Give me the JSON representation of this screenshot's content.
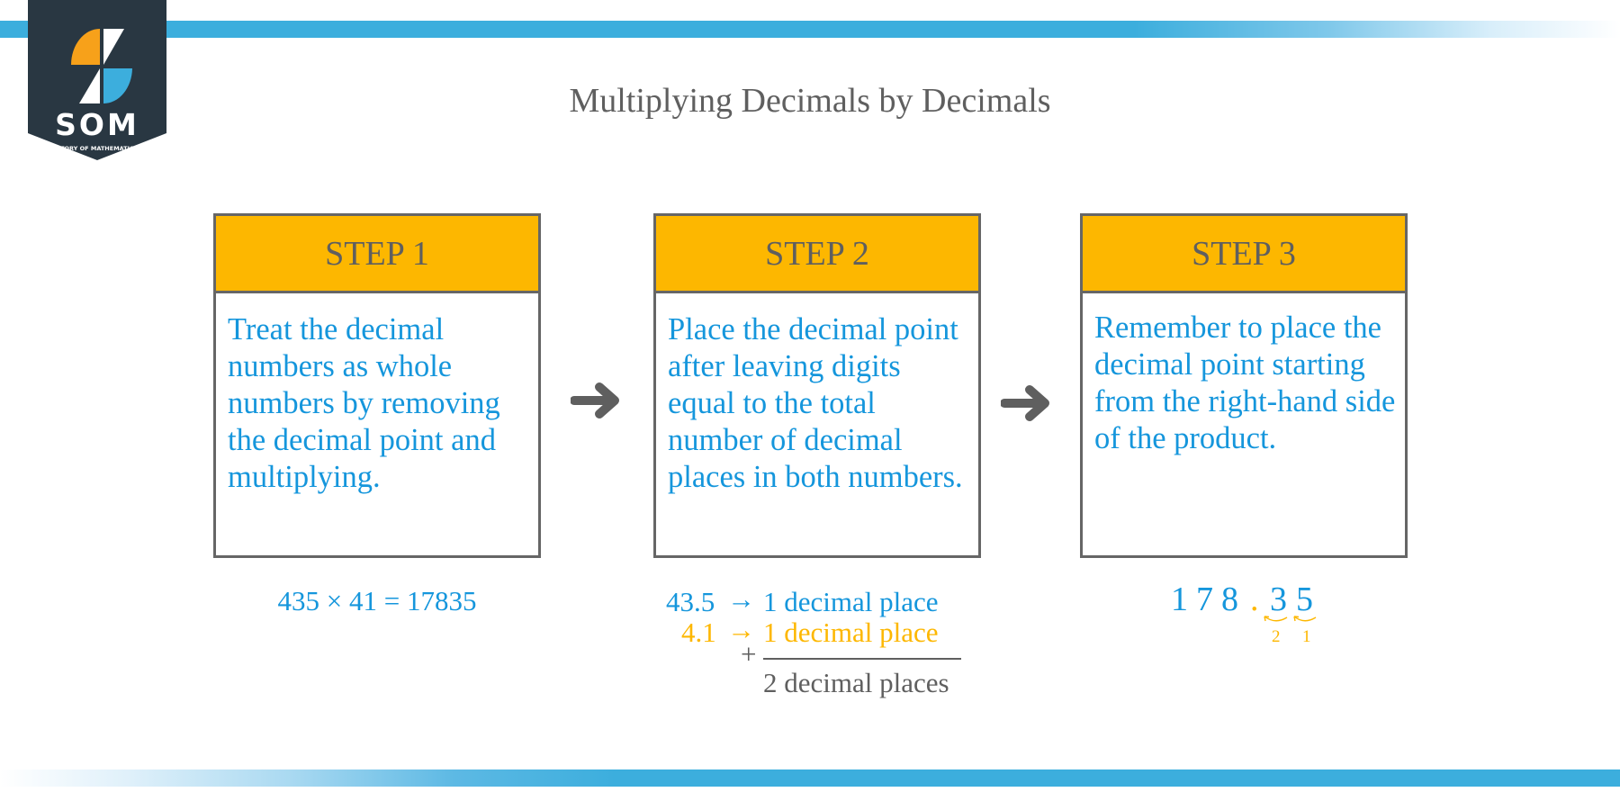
{
  "brand": {
    "logo_text": "SOM",
    "logo_subtitle": "STORY OF MATHEMATICS",
    "colors": {
      "banner": "#293742",
      "orange": "#f7a11a",
      "blue": "#3caedd",
      "white": "#ffffff"
    }
  },
  "title": "Multiplying Decimals by Decimals",
  "colors": {
    "accent_blue": "#1596dc",
    "header_orange": "#fdb700",
    "text_gray": "#5f5f5f",
    "border_gray": "#666666",
    "bar_blue": "#3caedd"
  },
  "steps": [
    {
      "header": "STEP 1",
      "body": "Treat the decimal numbers as whole numbers by removing the decimal point and multiplying.",
      "example": "435 × 41 = 17835"
    },
    {
      "header": "STEP 2",
      "body": "Place the decimal point after leaving digits equal to the total number of decimal places in both numbers.",
      "example": {
        "line1_number": "43.5",
        "line1_arrow": "→",
        "line1_text": "1 decimal place",
        "line2_number": "4.1",
        "line2_arrow": "→",
        "line2_text": "1 decimal place",
        "plus": "+",
        "sum": "2 decimal places"
      }
    },
    {
      "header": "STEP 3",
      "body": "Remember to place the decimal point starting from the right-hand side of the product.",
      "example": {
        "digits": [
          "1",
          "7",
          "8",
          ".",
          "3",
          "5"
        ],
        "place_counts": [
          "2",
          "1"
        ]
      }
    }
  ],
  "connectors": [
    "arrow-right",
    "arrow-right"
  ]
}
